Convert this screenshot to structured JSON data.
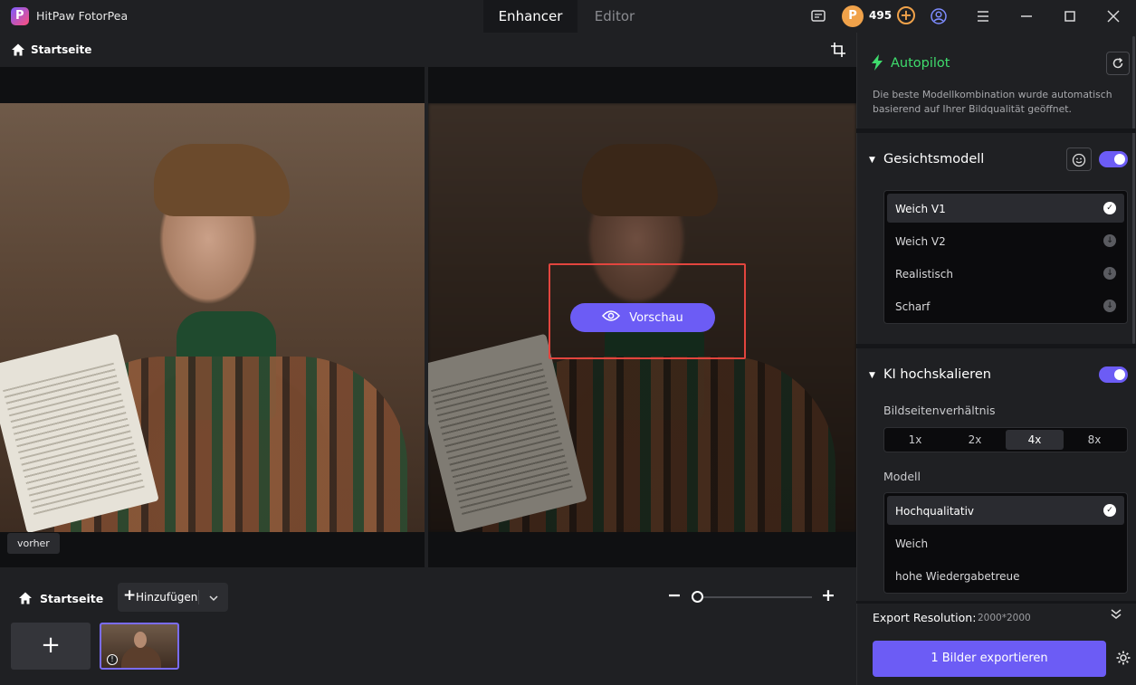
{
  "app": {
    "title": "HitPaw FotorPea"
  },
  "modes": {
    "enhancer": "Enhancer",
    "editor": "Editor"
  },
  "credits": {
    "count": "495"
  },
  "breadcrumb": {
    "home": "Startseite"
  },
  "canvas": {
    "before_tag": "vorher",
    "preview_button": "Vorschau"
  },
  "bottom": {
    "home": "Startseite",
    "add_label": "Hinzufügen"
  },
  "panel": {
    "autopilot": {
      "title": "Autopilot",
      "description": "Die beste Modellkombination wurde automatisch basierend auf Ihrer Bildqualität geöffnet."
    },
    "face_model": {
      "title": "Gesichtsmodell",
      "enabled": true,
      "items": [
        {
          "label": "Weich V1",
          "state": "selected"
        },
        {
          "label": "Weich V2",
          "state": "download"
        },
        {
          "label": "Realistisch",
          "state": "download"
        },
        {
          "label": "Scharf",
          "state": "download"
        }
      ]
    },
    "upscale": {
      "title": "KI hochskalieren",
      "enabled": true,
      "ratio_label": "Bildseitenverhältnis",
      "ratios": [
        "1x",
        "2x",
        "4x",
        "8x"
      ],
      "selected_ratio": "4x",
      "model_label": "Modell",
      "models": [
        {
          "label": "Hochqualitativ",
          "state": "selected"
        },
        {
          "label": "Weich",
          "state": "none"
        },
        {
          "label": "hohe Wiedergabetreue",
          "state": "none"
        }
      ]
    },
    "export": {
      "label": "Export Resolution:",
      "value": "2000*2000",
      "button": "1 Bilder exportieren"
    }
  },
  "colors": {
    "accent": "#6c5cf5",
    "autopilot": "#3fdc6d",
    "highlight": "#e2453e"
  }
}
